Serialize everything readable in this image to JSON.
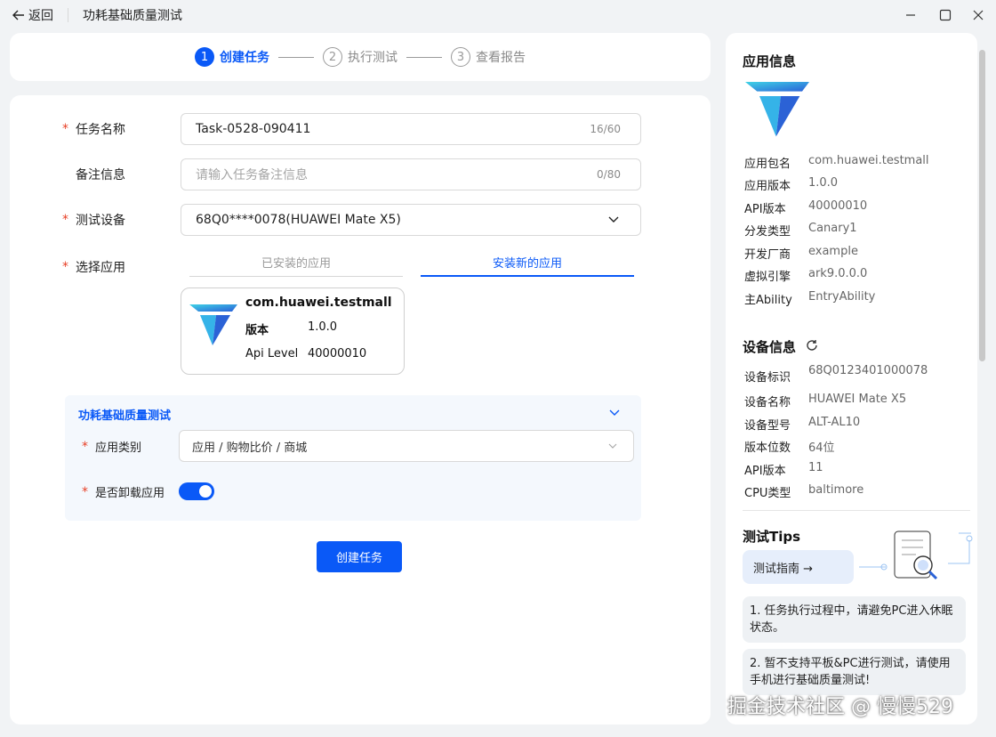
{
  "titlebar": {
    "back_label": "返回",
    "title": "功耗基础质量测试"
  },
  "steps": [
    {
      "num": "1",
      "label": "创建任务"
    },
    {
      "num": "2",
      "label": "执行测试"
    },
    {
      "num": "3",
      "label": "查看报告"
    }
  ],
  "form": {
    "task_name": {
      "label": "任务名称",
      "value": "Task-0528-090411",
      "count": "16/60"
    },
    "remark": {
      "label": "备注信息",
      "placeholder": "请输入任务备注信息",
      "count": "0/80"
    },
    "device": {
      "label": "测试设备",
      "value": "68Q0****0078(HUAWEI Mate X5)"
    },
    "app": {
      "label": "选择应用",
      "tabs": [
        "已安装的应用",
        "安装新的应用"
      ],
      "card": {
        "name": "com.huawei.testmall",
        "version_key": "版本",
        "version": "1.0.0",
        "api_key": "Api Level",
        "api": "40000010"
      }
    },
    "panel": {
      "title": "功耗基础质量测试",
      "category_label": "应用类别",
      "category_value": "应用 / 购物比价 / 商城",
      "uninstall_label": "是否卸载应用",
      "uninstall_on": true
    },
    "submit_label": "创建任务"
  },
  "side": {
    "app_title": "应用信息",
    "app_info": [
      {
        "k": "应用包名",
        "v": "com.huawei.testmall"
      },
      {
        "k": "应用版本",
        "v": "1.0.0"
      },
      {
        "k": "API版本",
        "v": "40000010"
      },
      {
        "k": "分发类型",
        "v": "Canary1"
      },
      {
        "k": "开发厂商",
        "v": "example"
      },
      {
        "k": "虚拟引擎",
        "v": "ark9.0.0.0"
      },
      {
        "k": "主Ability",
        "v": "EntryAbility"
      }
    ],
    "device_title": "设备信息",
    "device_info": [
      {
        "k": "设备标识",
        "v": "68Q0123401000078"
      },
      {
        "k": "设备名称",
        "v": "HUAWEI Mate X5"
      },
      {
        "k": "设备型号",
        "v": "ALT-AL10"
      },
      {
        "k": "版本位数",
        "v": "64位"
      },
      {
        "k": "API版本",
        "v": "11"
      },
      {
        "k": "CPU类型",
        "v": "baltimore"
      }
    ],
    "tips_title": "测试Tips",
    "guide_label": "测试指南 →",
    "tips": [
      "1. 任务执行过程中，请避免PC进入休眠状态。",
      "2. 暂不支持平板&PC进行测试，请使用手机进行基础质量测试!"
    ]
  },
  "watermark": "掘金技术社区 @ 慢慢529",
  "colors": {
    "accent": "#0a59f7",
    "required": "#e84026"
  }
}
